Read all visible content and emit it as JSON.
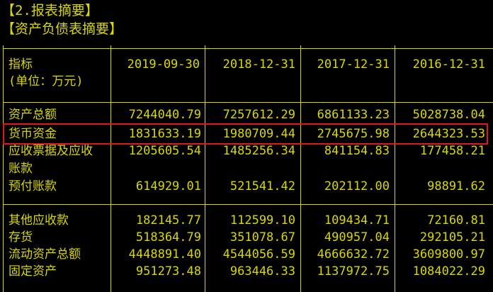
{
  "section_title": "【2.报表摘要】",
  "table_title": "【资产负债表摘要】",
  "header": {
    "label_line1": "指标",
    "label_line2": "(单位：万元)",
    "dates": [
      "2019-09-30",
      "2018-12-31",
      "2017-12-31",
      "2016-12-31"
    ]
  },
  "rows": [
    {
      "label": "资产总额",
      "values": [
        "7244040.79",
        "7257612.29",
        "6861133.23",
        "5028738.04"
      ]
    },
    {
      "label": "货币资金",
      "values": [
        "1831633.19",
        "1980709.44",
        "2745675.98",
        "2644323.53"
      ]
    },
    {
      "label": "应收票据及应收",
      "values": [
        "1205605.54",
        "1485256.34",
        "841154.83",
        "177458.21"
      ]
    },
    {
      "label": "账款",
      "values": [
        "",
        "",
        "",
        ""
      ]
    },
    {
      "label": "预付账款",
      "values": [
        "614929.01",
        "521541.42",
        "202112.00",
        "98891.62"
      ]
    },
    {
      "label": "其他应收款",
      "values": [
        "182145.77",
        "112599.10",
        "109434.71",
        "72160.81"
      ]
    },
    {
      "label": "存货",
      "values": [
        "518364.79",
        "351078.67",
        "490957.04",
        "292105.21"
      ]
    },
    {
      "label": "流动资产总额",
      "values": [
        "4448891.40",
        "4544056.59",
        "4666632.72",
        "3609800.97"
      ]
    },
    {
      "label": "固定资产",
      "values": [
        "951273.48",
        "963446.33",
        "1137972.75",
        "1084022.29"
      ]
    }
  ],
  "highlight_color": "#e01818",
  "text_color": "#d8d800"
}
